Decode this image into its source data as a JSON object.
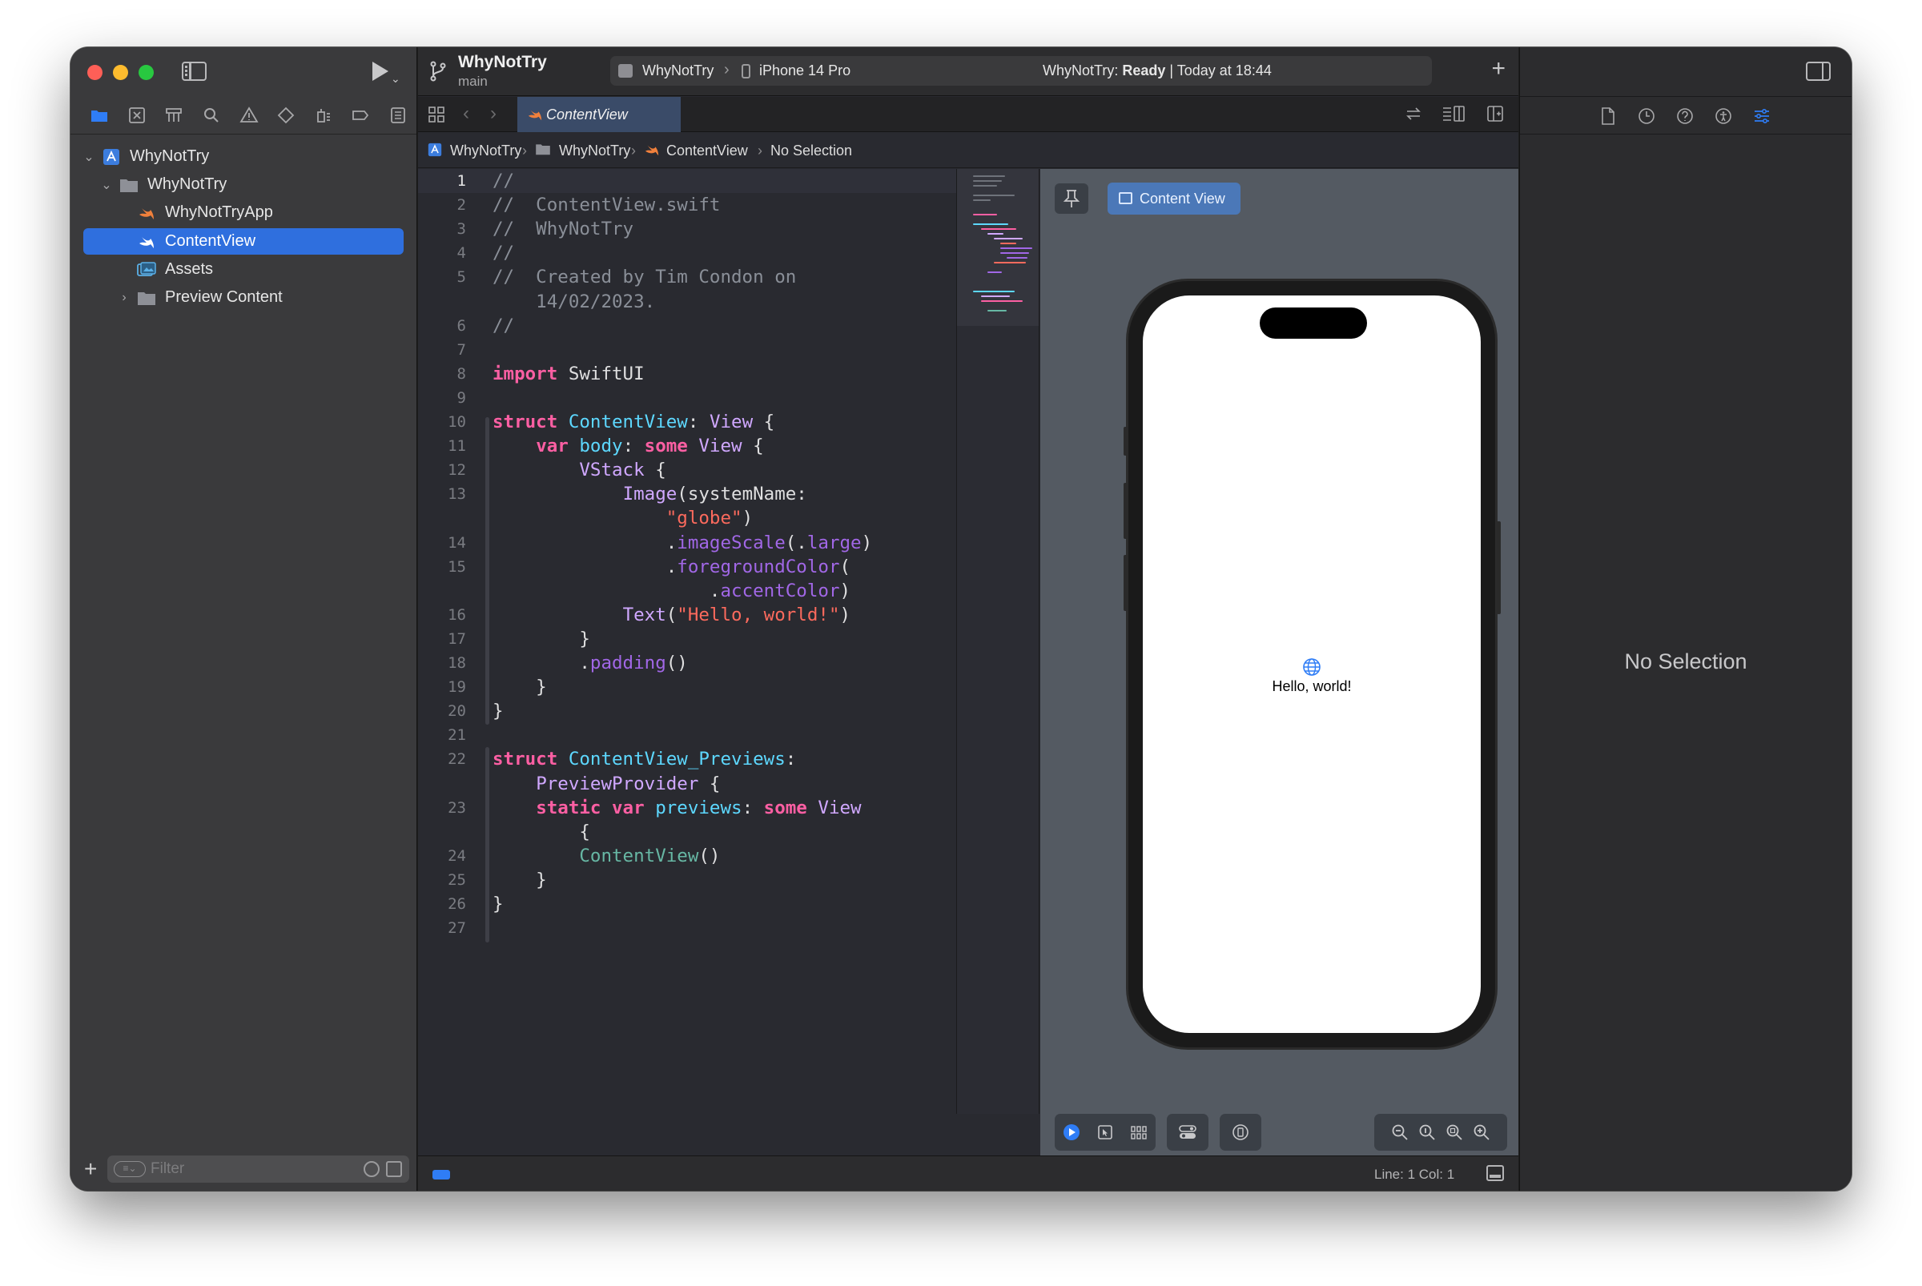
{
  "toolbar": {
    "project_title": "WhyNotTry",
    "branch": "main",
    "scheme_name": "WhyNotTry",
    "device_name": "iPhone 14 Pro",
    "status_app": "WhyNotTry:",
    "status_state": "Ready",
    "status_time": "| Today at 18:44"
  },
  "navigator": {
    "tree": [
      {
        "label": "WhyNotTry",
        "icon": "project-icon",
        "expanded": true
      },
      {
        "label": "WhyNotTry",
        "icon": "folder-icon",
        "expanded": true
      },
      {
        "label": "WhyNotTryApp",
        "icon": "swift-file-icon"
      },
      {
        "label": "ContentView",
        "icon": "swift-file-icon",
        "selected": true
      },
      {
        "label": "Assets",
        "icon": "assets-icon"
      },
      {
        "label": "Preview Content",
        "icon": "folder-icon",
        "expanded": false
      }
    ],
    "filter_placeholder": "Filter"
  },
  "tab": {
    "active_label": "ContentView"
  },
  "jumpbar": {
    "items": [
      "WhyNotTry",
      "WhyNotTry",
      "ContentView",
      "No Selection"
    ]
  },
  "code": {
    "lines": [
      {
        "n": "1",
        "html": "<span class='cm'>//</span>"
      },
      {
        "n": "2",
        "html": "<span class='cm'>//  ContentView.swift</span>"
      },
      {
        "n": "3",
        "html": "<span class='cm'>//  WhyNotTry</span>"
      },
      {
        "n": "4",
        "html": "<span class='cm'>//</span>"
      },
      {
        "n": "5",
        "html": "<span class='cm'>//  Created by Tim Condon on</span>"
      },
      {
        "n": "",
        "html": "<span class='cm'>    14/02/2023.</span>"
      },
      {
        "n": "6",
        "html": "<span class='cm'>//</span>"
      },
      {
        "n": "7",
        "html": ""
      },
      {
        "n": "8",
        "html": "<span class='k'>import</span> <span class='pl'>SwiftUI</span>"
      },
      {
        "n": "9",
        "html": ""
      },
      {
        "n": "10",
        "html": "<span class='k'>struct</span> <span class='t'>ContentView</span>: <span class='ty'>View</span> {"
      },
      {
        "n": "11",
        "html": "    <span class='k'>var</span> <span class='t'>body</span>: <span class='k'>some</span> <span class='ty'>View</span> {"
      },
      {
        "n": "12",
        "html": "        <span class='ty'>VStack</span> {"
      },
      {
        "n": "13",
        "html": "            <span class='ty'>Image</span>(systemName:"
      },
      {
        "n": "",
        "html": "                <span class='s'>\"globe\"</span>)"
      },
      {
        "n": "14",
        "html": "                .<span class='m'>imageScale</span>(.<span class='m'>large</span>)"
      },
      {
        "n": "15",
        "html": "                .<span class='m'>foregroundColor</span>("
      },
      {
        "n": "",
        "html": "                    .<span class='m'>accentColor</span>)"
      },
      {
        "n": "16",
        "html": "            <span class='ty'>Text</span>(<span class='s'>\"Hello, world!\"</span>)"
      },
      {
        "n": "17",
        "html": "        }"
      },
      {
        "n": "18",
        "html": "        .<span class='m'>padding</span>()"
      },
      {
        "n": "19",
        "html": "    }"
      },
      {
        "n": "20",
        "html": "}"
      },
      {
        "n": "21",
        "html": ""
      },
      {
        "n": "22",
        "html": "<span class='k'>struct</span> <span class='t'>ContentView_Previews</span>:"
      },
      {
        "n": "",
        "html": "    <span class='ty'>PreviewProvider</span> {"
      },
      {
        "n": "23",
        "html": "    <span class='k'>static</span> <span class='k'>var</span> <span class='t'>previews</span>: <span class='k'>some</span> <span class='ty'>View</span>"
      },
      {
        "n": "",
        "html": "        {"
      },
      {
        "n": "24",
        "html": "        <span class='fn'>ContentView</span>()"
      },
      {
        "n": "25",
        "html": "    }"
      },
      {
        "n": "26",
        "html": "}"
      },
      {
        "n": "27",
        "html": ""
      }
    ]
  },
  "canvas": {
    "preview_label": "Content View",
    "hello_text": "Hello, world!"
  },
  "statusbar": {
    "position": "Line: 1  Col: 1"
  },
  "inspector": {
    "empty_label": "No Selection"
  },
  "colors": {
    "accent": "#2f6fde",
    "close": "#fe5f57",
    "minimize": "#febc2e",
    "zoom": "#28c840",
    "keyword": "#fc5fa3",
    "type_decl": "#5dd8ff",
    "type": "#d0a8ff",
    "string": "#fc6a5d",
    "comment": "#8a8f98"
  }
}
